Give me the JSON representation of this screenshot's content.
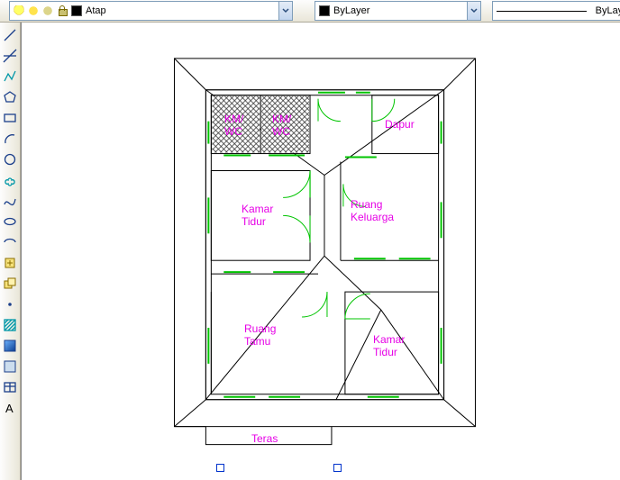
{
  "toolbar": {
    "layer_name": "Atap",
    "color_name": "ByLayer",
    "linetype_name": "ByLayer"
  },
  "rooms": {
    "km1": "KM/\nWC",
    "km2": "KM/\nWC",
    "dapur": "Dapur",
    "kamar1": "Kamar\nTidur",
    "keluarga": "Ruang\nKeluarga",
    "tamu": "Ruang\nTamu",
    "kamar2": "Kamar\nTidur",
    "teras": "Teras"
  },
  "tools": {
    "layer_props": "layer-properties",
    "layer_states": "layer-states",
    "color_control": "color-control",
    "linetype": "linetype-control"
  }
}
